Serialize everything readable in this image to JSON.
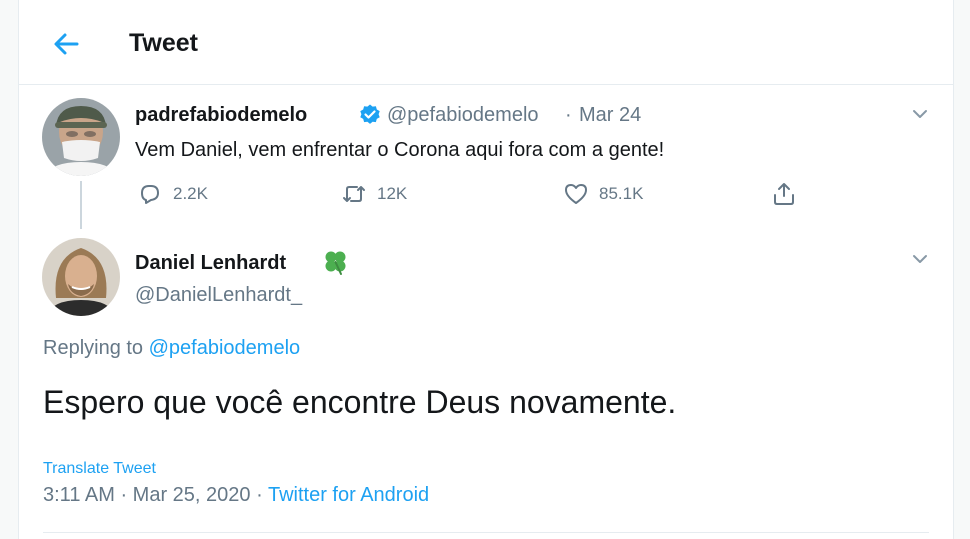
{
  "header": {
    "title": "Tweet"
  },
  "parent_tweet": {
    "display_name": "padrefabiodemelo",
    "handle": "@pefabiodemelo",
    "separator": "·",
    "date": "Mar 24",
    "text": "Vem Daniel, vem enfrentar o Corona aqui fora com a gente!",
    "actions": {
      "reply_count": "2.2K",
      "retweet_count": "12K",
      "like_count": "85.1K"
    }
  },
  "reply_tweet": {
    "display_name": "Daniel Lenhardt",
    "handle": "@DanielLenhardt_",
    "replying_prefix": "Replying to",
    "replying_handle": "@pefabiodemelo",
    "text": "Espero que você encontre Deus novamente.",
    "translate_label": "Translate Tweet",
    "timestamp": "3:11 AM · Mar 25, 2020",
    "meta_separator": "·",
    "source": "Twitter for Android"
  },
  "colors": {
    "accent": "#1da1f2",
    "muted": "#657786",
    "text": "#14171a",
    "clover": "#4caf50"
  },
  "icons": {
    "back": "arrow-left-icon",
    "verified": "verified-badge-icon",
    "clover": "four-leaf-clover-icon",
    "reply": "reply-icon",
    "retweet": "retweet-icon",
    "like": "heart-icon",
    "share": "share-icon",
    "more": "chevron-down-icon"
  }
}
